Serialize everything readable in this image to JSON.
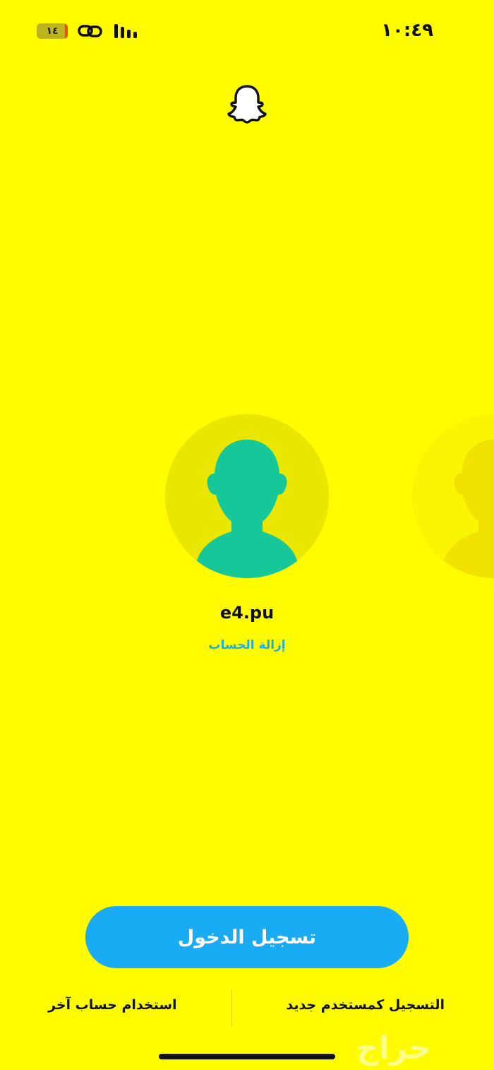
{
  "status_bar": {
    "time": "١٠:٤٩",
    "battery": "١٤",
    "link_icon": "link-icon",
    "signal_icon": "signal-bars-icon"
  },
  "app": {
    "logo_icon": "snapchat-ghost-icon"
  },
  "account": {
    "username": "e4.pu",
    "remove_label": "إزالة الحساب"
  },
  "actions": {
    "login_label": "تسجيل الدخول",
    "signup_label": "التسجيل كمستخدم جديد",
    "other_account_label": "استخدام حساب آخر"
  },
  "watermark": {
    "text": "حراج"
  },
  "colors": {
    "background": "#FFFC00",
    "button": "#1AABF5",
    "link": "#1AAEE8",
    "avatar": "#16C79A"
  }
}
